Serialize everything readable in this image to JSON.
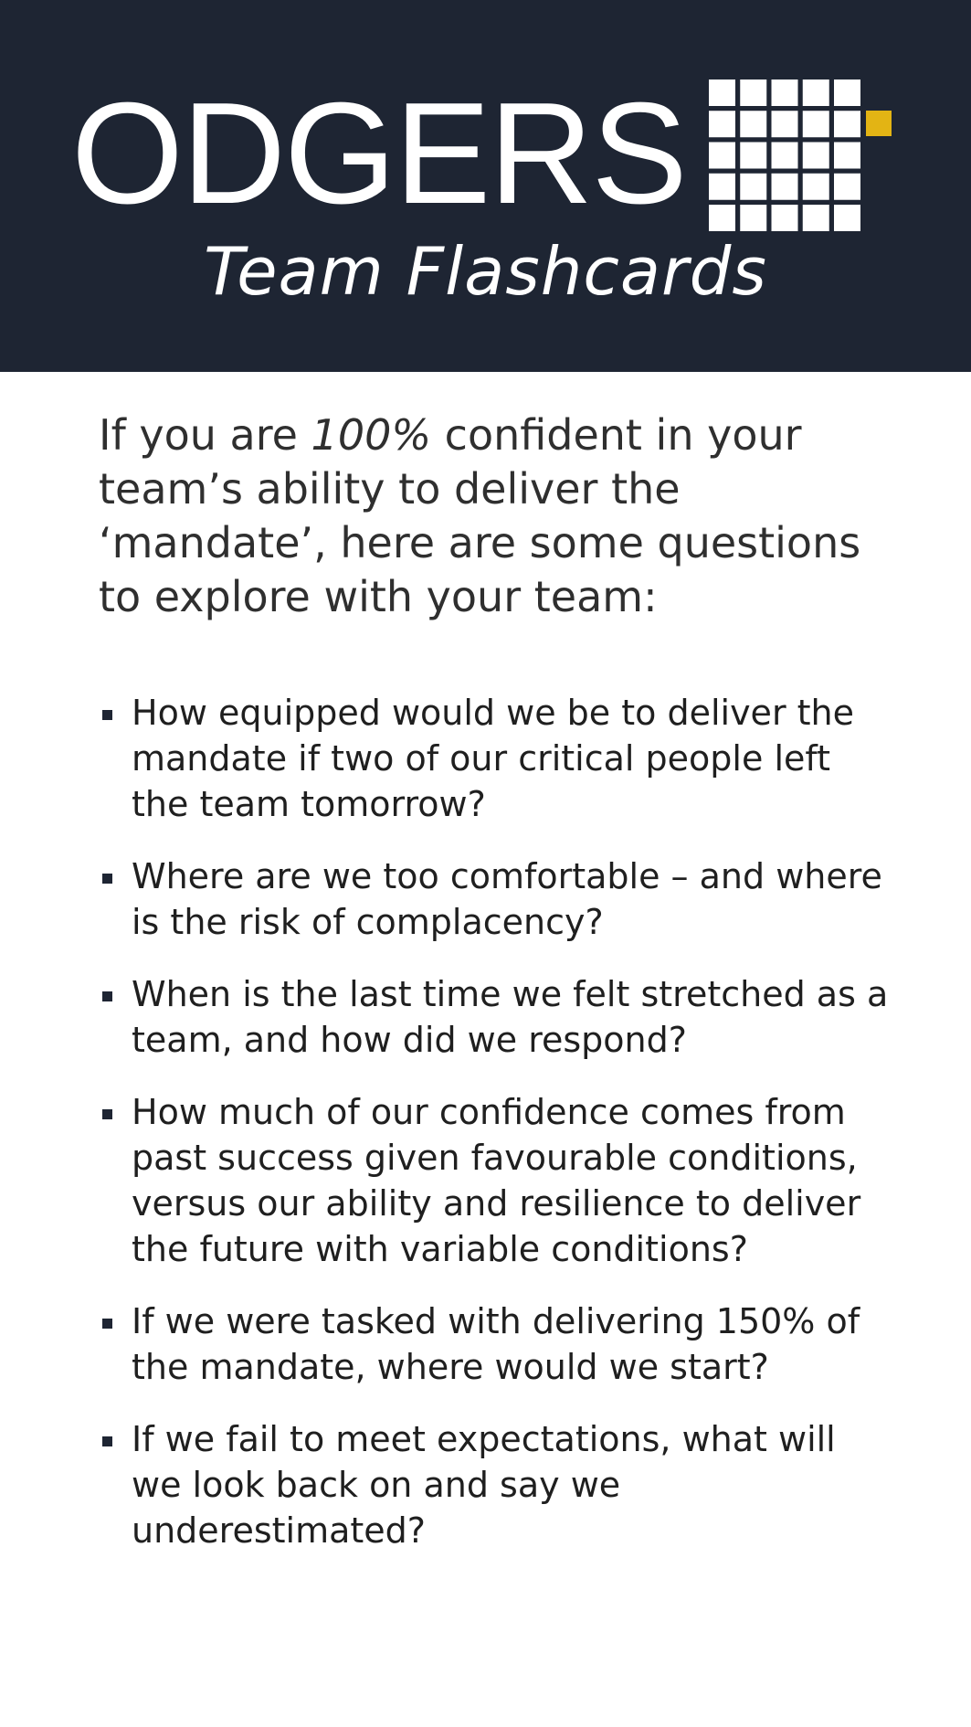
{
  "header": {
    "logo_wordmark": "ODGERS",
    "subtitle": "Team Flashcards",
    "colors": {
      "background": "#1e2533",
      "accent": "#e3b414",
      "text": "#ffffff"
    }
  },
  "intro": {
    "before": "If you are ",
    "emphasis": "100%",
    "after": " confident in your team’s ability to deliver the ‘mandate’, here are some questions to explore with your team:"
  },
  "questions": [
    "How equipped would we be to deliver the mandate if two of our critical people left the team tomorrow?",
    "Where are we too comfortable – and where is the risk of complacency?",
    "When is the last time we felt stretched as a team, and how did we respond?",
    "How much of our confidence comes from past success given favourable conditions, versus our ability and resilience to deliver the future with variable conditions?",
    "If we were tasked with delivering 150% of the mandate, where would we start?",
    "If we fail to meet expectations, what will we look back on and say we underestimated?"
  ]
}
